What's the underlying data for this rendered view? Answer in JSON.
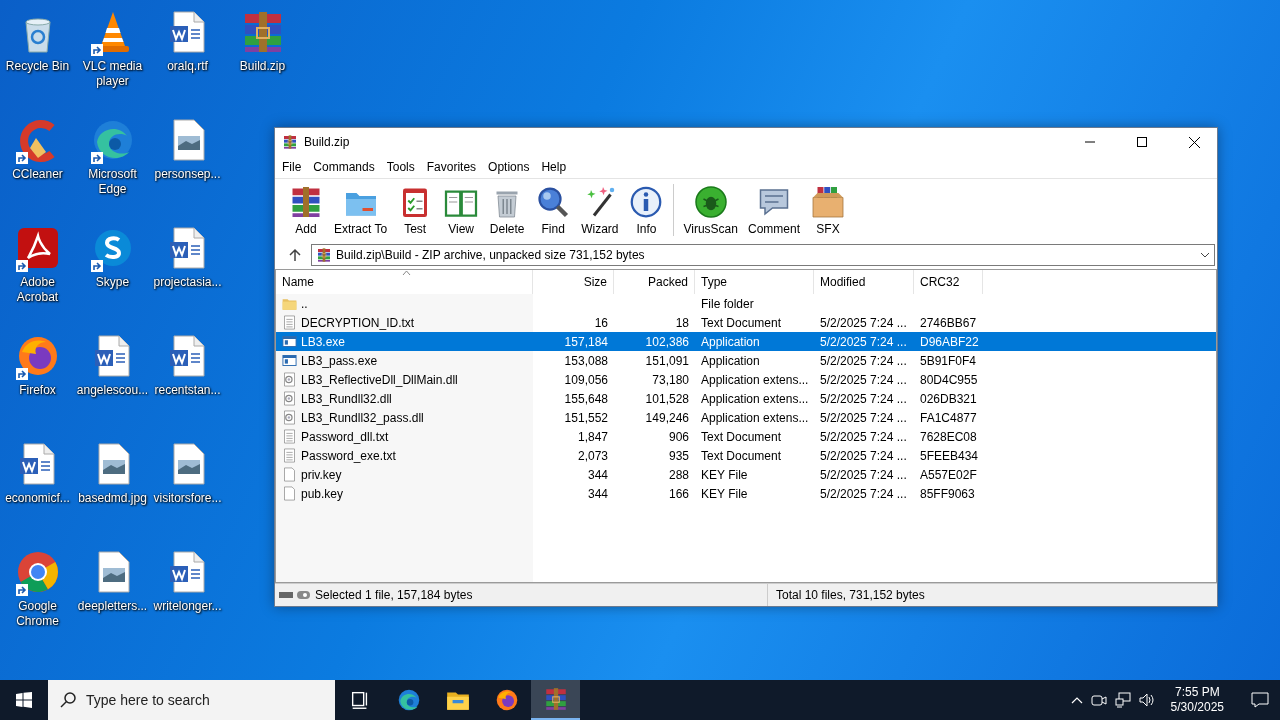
{
  "desktop_icons": [
    {
      "label": "Recycle Bin",
      "kind": "recycle",
      "shortcut": false
    },
    {
      "label": "CCleaner",
      "kind": "ccleaner",
      "shortcut": true
    },
    {
      "label": "Adobe Acrobat",
      "kind": "acrobat",
      "shortcut": true
    },
    {
      "label": "Firefox",
      "kind": "firefox",
      "shortcut": true
    },
    {
      "label": "economicf...",
      "kind": "word",
      "shortcut": false
    },
    {
      "label": "Google Chrome",
      "kind": "chrome",
      "shortcut": true
    },
    {
      "label": "VLC media player",
      "kind": "vlc",
      "shortcut": true
    },
    {
      "label": "Microsoft Edge",
      "kind": "edge",
      "shortcut": true
    },
    {
      "label": "Skype",
      "kind": "skype",
      "shortcut": true
    },
    {
      "label": "angelescou...",
      "kind": "word",
      "shortcut": false
    },
    {
      "label": "basedmd.jpg",
      "kind": "image",
      "shortcut": false
    },
    {
      "label": "deepletters...",
      "kind": "image",
      "shortcut": false
    },
    {
      "label": "oralq.rtf",
      "kind": "word",
      "shortcut": false
    },
    {
      "label": "personsep...",
      "kind": "image",
      "shortcut": false
    },
    {
      "label": "projectasia...",
      "kind": "word",
      "shortcut": false
    },
    {
      "label": "recentstan...",
      "kind": "word",
      "shortcut": false
    },
    {
      "label": "visitorsfore...",
      "kind": "image",
      "shortcut": false
    },
    {
      "label": "writelonger...",
      "kind": "word",
      "shortcut": false
    },
    {
      "label": "Build.zip",
      "kind": "winrar",
      "shortcut": false
    }
  ],
  "window": {
    "title": "Build.zip",
    "menu": [
      "File",
      "Commands",
      "Tools",
      "Favorites",
      "Options",
      "Help"
    ],
    "toolbar_groups": [
      [
        {
          "label": "Add",
          "kind": "add"
        },
        {
          "label": "Extract To",
          "kind": "extract"
        },
        {
          "label": "Test",
          "kind": "test"
        },
        {
          "label": "View",
          "kind": "view"
        },
        {
          "label": "Delete",
          "kind": "delete"
        },
        {
          "label": "Find",
          "kind": "find"
        },
        {
          "label": "Wizard",
          "kind": "wizard"
        },
        {
          "label": "Info",
          "kind": "info"
        }
      ],
      [
        {
          "label": "VirusScan",
          "kind": "virusscan"
        },
        {
          "label": "Comment",
          "kind": "comment"
        },
        {
          "label": "SFX",
          "kind": "sfx"
        }
      ]
    ],
    "address": "Build.zip\\Build - ZIP archive, unpacked size 731,152 bytes",
    "columns": [
      {
        "label": "Name",
        "sorted": true
      },
      {
        "label": "Size",
        "sorted": false
      },
      {
        "label": "Packed",
        "sorted": false
      },
      {
        "label": "Type",
        "sorted": false
      },
      {
        "label": "Modified",
        "sorted": false
      },
      {
        "label": "CRC32",
        "sorted": false
      }
    ],
    "rows": [
      {
        "kind": "folder",
        "name": "..",
        "type": "File folder",
        "selected": false
      },
      {
        "kind": "text",
        "name": "DECRYPTION_ID.txt",
        "size": "16",
        "packed": "18",
        "type": "Text Document",
        "modified": "5/2/2025 7:24 ...",
        "crc": "2746BB67",
        "selected": false
      },
      {
        "kind": "app",
        "name": "LB3.exe",
        "size": "157,184",
        "packed": "102,386",
        "type": "Application",
        "modified": "5/2/2025 7:24 ...",
        "crc": "D96ABF22",
        "selected": true
      },
      {
        "kind": "app",
        "name": "LB3_pass.exe",
        "size": "153,088",
        "packed": "151,091",
        "type": "Application",
        "modified": "5/2/2025 7:24 ...",
        "crc": "5B91F0F4",
        "selected": false
      },
      {
        "kind": "dll",
        "name": "LB3_ReflectiveDll_DllMain.dll",
        "size": "109,056",
        "packed": "73,180",
        "type": "Application extens...",
        "modified": "5/2/2025 7:24 ...",
        "crc": "80D4C955",
        "selected": false
      },
      {
        "kind": "dll",
        "name": "LB3_Rundll32.dll",
        "size": "155,648",
        "packed": "101,528",
        "type": "Application extens...",
        "modified": "5/2/2025 7:24 ...",
        "crc": "026DB321",
        "selected": false
      },
      {
        "kind": "dll",
        "name": "LB3_Rundll32_pass.dll",
        "size": "151,552",
        "packed": "149,246",
        "type": "Application extens...",
        "modified": "5/2/2025 7:24 ...",
        "crc": "FA1C4877",
        "selected": false
      },
      {
        "kind": "text",
        "name": "Password_dll.txt",
        "size": "1,847",
        "packed": "906",
        "type": "Text Document",
        "modified": "5/2/2025 7:24 ...",
        "crc": "7628EC08",
        "selected": false
      },
      {
        "kind": "text",
        "name": "Password_exe.txt",
        "size": "2,073",
        "packed": "935",
        "type": "Text Document",
        "modified": "5/2/2025 7:24 ...",
        "crc": "5FEEB434",
        "selected": false
      },
      {
        "kind": "blank",
        "name": "priv.key",
        "size": "344",
        "packed": "288",
        "type": "KEY File",
        "modified": "5/2/2025 7:24 ...",
        "crc": "A557E02F",
        "selected": false
      },
      {
        "kind": "blank",
        "name": "pub.key",
        "size": "344",
        "packed": "166",
        "type": "KEY File",
        "modified": "5/2/2025 7:24 ...",
        "crc": "85FF9063",
        "selected": false
      }
    ],
    "status_left": "Selected 1 file, 157,184 bytes",
    "status_right": "Total 10 files, 731,152 bytes"
  },
  "taskbar": {
    "search": {
      "placeholder": "Type here to search"
    },
    "apps": [
      {
        "kind": "taskview",
        "active": false
      },
      {
        "kind": "edge",
        "active": false
      },
      {
        "kind": "explorer",
        "active": false
      },
      {
        "kind": "firefox",
        "active": false
      },
      {
        "kind": "winrar",
        "active": true
      }
    ],
    "time": "7:55 PM",
    "date": "5/30/2025"
  }
}
